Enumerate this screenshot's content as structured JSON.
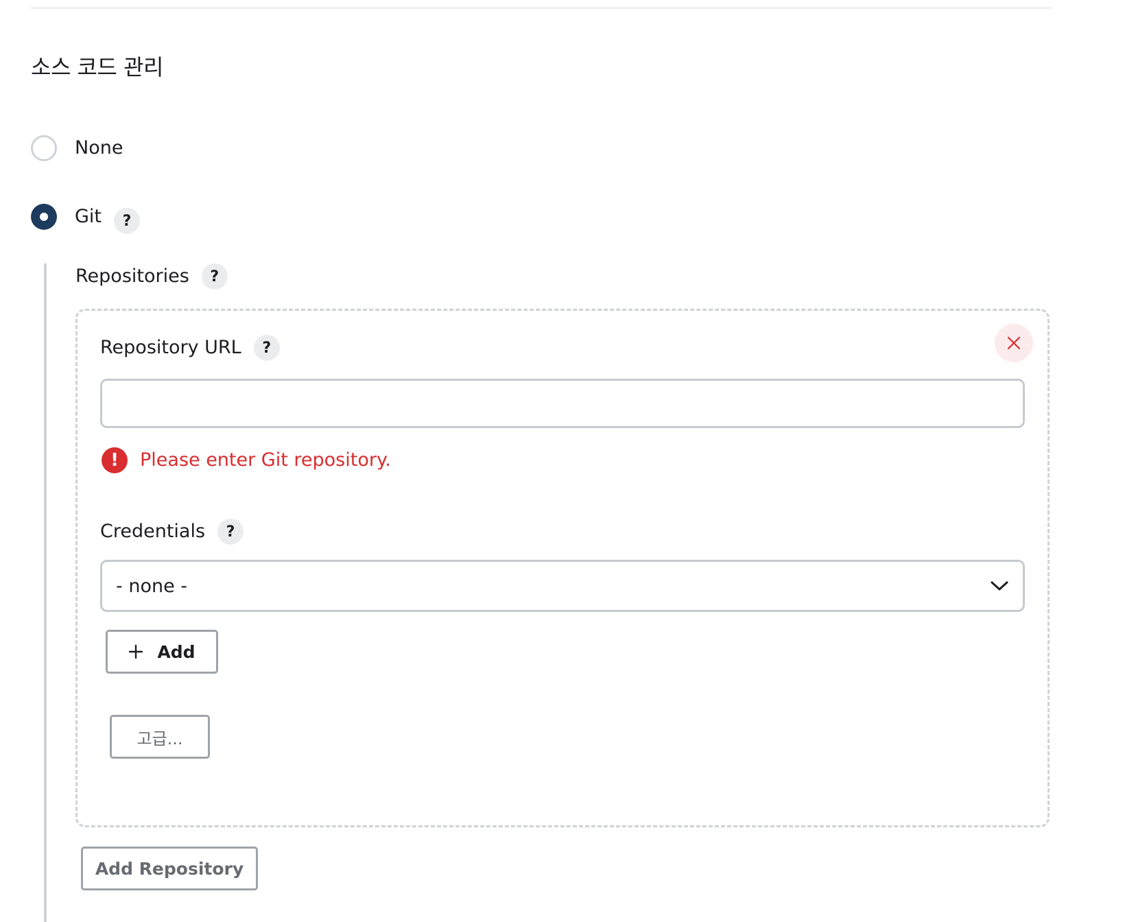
{
  "section": {
    "title": "소스 코드 관리"
  },
  "scm_options": [
    {
      "label": "None",
      "selected": false
    },
    {
      "label": "Git",
      "selected": true
    }
  ],
  "help_icon_text": "?",
  "git": {
    "repositories_label": "Repositories",
    "repository_url": {
      "label": "Repository URL",
      "value": "",
      "error": "Please enter Git repository.",
      "error_icon_text": "!"
    },
    "credentials": {
      "label": "Credentials",
      "selected": "- none -"
    },
    "add_button_label": "Add",
    "advanced_button_label": "고급...",
    "add_repository_button_label": "Add Repository"
  },
  "colors": {
    "accent": "#1c3b5e",
    "error": "#d92d2f",
    "border": "#c6cbd0"
  }
}
